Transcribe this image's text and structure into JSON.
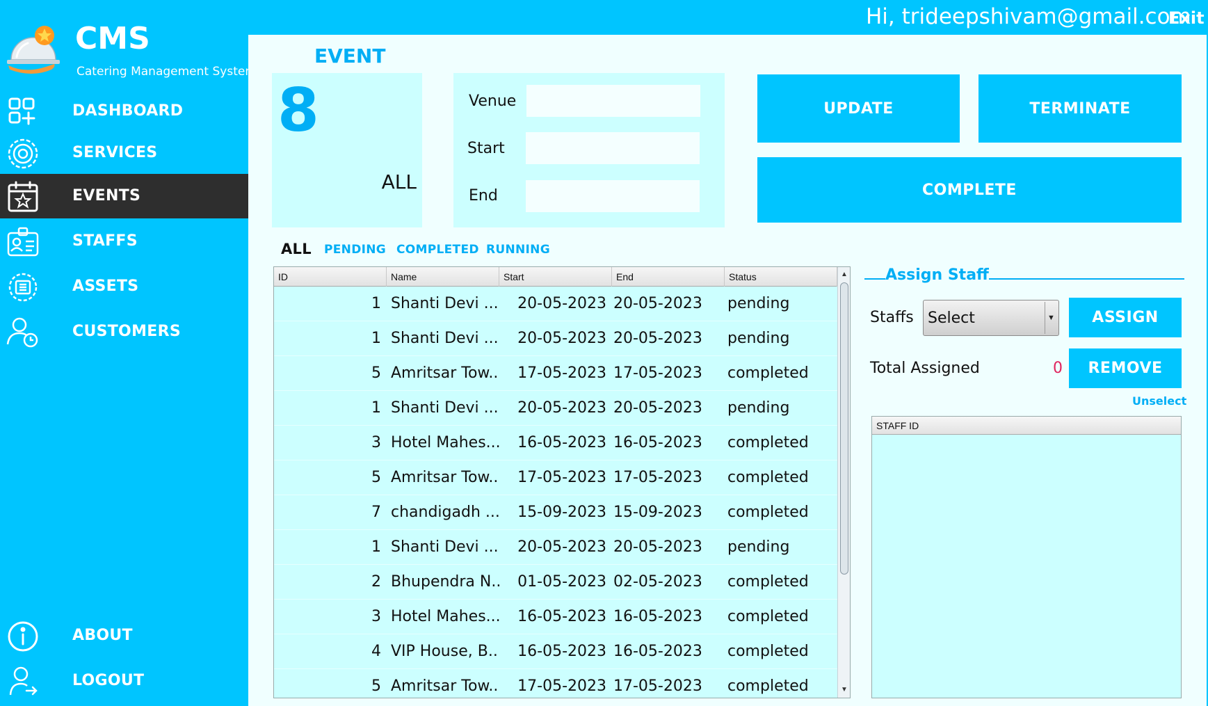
{
  "header": {
    "greeting": "Hi, trideepshivam@gmail.com",
    "exit_label": "Exit"
  },
  "app": {
    "name": "CMS",
    "subtitle": "Catering Management System",
    "logo_icon": "cloche-star-icon"
  },
  "sidebar": {
    "items": [
      {
        "label": "DASHBOARD",
        "icon": "dashboard-grid-icon",
        "active": false
      },
      {
        "label": "SERVICES",
        "icon": "gear-icon",
        "active": false
      },
      {
        "label": "EVENTS",
        "icon": "calendar-star-icon",
        "active": true
      },
      {
        "label": "STAFFS",
        "icon": "id-card-icon",
        "active": false
      },
      {
        "label": "ASSETS",
        "icon": "chip-gear-icon",
        "active": false
      },
      {
        "label": "CUSTOMERS",
        "icon": "user-clock-icon",
        "active": false
      }
    ],
    "bottom_items": [
      {
        "label": "ABOUT",
        "icon": "info-icon"
      },
      {
        "label": "LOGOUT",
        "icon": "user-arrow-icon"
      }
    ]
  },
  "main": {
    "title": "EVENT",
    "count": {
      "value": "8",
      "filter": "ALL"
    },
    "details": {
      "venue_label": "Venue",
      "venue_value": "",
      "start_label": "Start",
      "start_value": "",
      "end_label": "End",
      "end_value": ""
    },
    "buttons": {
      "update": "UPDATE",
      "terminate": "TERMINATE",
      "complete": "COMPLETE"
    },
    "tabs": [
      {
        "label": "ALL",
        "active": true
      },
      {
        "label": "PENDING",
        "active": false
      },
      {
        "label": "COMPLETED",
        "active": false
      },
      {
        "label": "RUNNING",
        "active": false
      }
    ],
    "table": {
      "columns": [
        "ID",
        "Name",
        "Start",
        "End",
        "Status"
      ],
      "rows": [
        [
          "1",
          "Shanti Devi ...",
          "20-05-2023",
          "20-05-2023",
          "pending"
        ],
        [
          "1",
          "Shanti Devi ...",
          "20-05-2023",
          "20-05-2023",
          "pending"
        ],
        [
          "5",
          "Amritsar Tow...",
          "17-05-2023",
          "17-05-2023",
          "completed"
        ],
        [
          "1",
          "Shanti Devi ...",
          "20-05-2023",
          "20-05-2023",
          "pending"
        ],
        [
          "3",
          "Hotel Mahes...",
          "16-05-2023",
          "16-05-2023",
          "completed"
        ],
        [
          "5",
          "Amritsar Tow...",
          "17-05-2023",
          "17-05-2023",
          "completed"
        ],
        [
          "7",
          "chandigadh ...",
          "15-09-2023",
          "15-09-2023",
          "completed"
        ],
        [
          "1",
          "Shanti Devi ...",
          "20-05-2023",
          "20-05-2023",
          "pending"
        ],
        [
          "2",
          "Bhupendra N...",
          "01-05-2023",
          "02-05-2023",
          "completed"
        ],
        [
          "3",
          "Hotel Mahes...",
          "16-05-2023",
          "16-05-2023",
          "completed"
        ],
        [
          "4",
          "VIP House, B...",
          "16-05-2023",
          "16-05-2023",
          "completed"
        ],
        [
          "5",
          "Amritsar Tow...",
          "17-05-2023",
          "17-05-2023",
          "completed"
        ]
      ]
    },
    "assign": {
      "title": "Assign Staff",
      "staffs_label": "Staffs",
      "select_value": "Select",
      "assign_button": "ASSIGN",
      "total_label": "Total Assigned",
      "total_value": "0",
      "remove_button": "REMOVE",
      "unselect_label": "Unselect",
      "staff_table_header": "STAFF ID"
    }
  },
  "colors": {
    "accent": "#00c5ff",
    "accent_text": "#00aef5",
    "panel": "#ccffff",
    "main_bg": "#f0ffff",
    "active_nav": "#2e2e2e",
    "total_value": "#e0245e"
  }
}
